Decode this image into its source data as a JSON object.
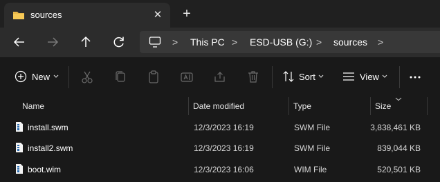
{
  "tab": {
    "title": "sources",
    "folder_icon": "folder-icon",
    "close_icon": "close-icon",
    "new_tab_icon": "plus-icon"
  },
  "nav": {
    "back_icon": "arrow-left-icon",
    "forward_icon": "arrow-right-icon",
    "up_icon": "arrow-up-icon",
    "refresh_icon": "refresh-icon"
  },
  "address": {
    "computer_icon": "monitor-icon",
    "segments": [
      "This PC",
      "ESD-USB (G:)",
      "sources"
    ]
  },
  "toolbar": {
    "new_label": "New",
    "sort_label": "Sort",
    "view_label": "View",
    "more_icon": "more-icon"
  },
  "columns": {
    "name": "Name",
    "date_modified": "Date modified",
    "type": "Type",
    "size": "Size"
  },
  "files": [
    {
      "name": "install.swm",
      "date": "12/3/2023 16:19",
      "type": "SWM File",
      "size": "3,838,461 KB"
    },
    {
      "name": "install2.swm",
      "date": "12/3/2023 16:19",
      "type": "SWM File",
      "size": "839,044 KB"
    },
    {
      "name": "boot.wim",
      "date": "12/3/2023 16:06",
      "type": "WIM File",
      "size": "520,501 KB"
    }
  ],
  "colors": {
    "folder": "#e8b84a",
    "accent": "#4cc2ff"
  }
}
